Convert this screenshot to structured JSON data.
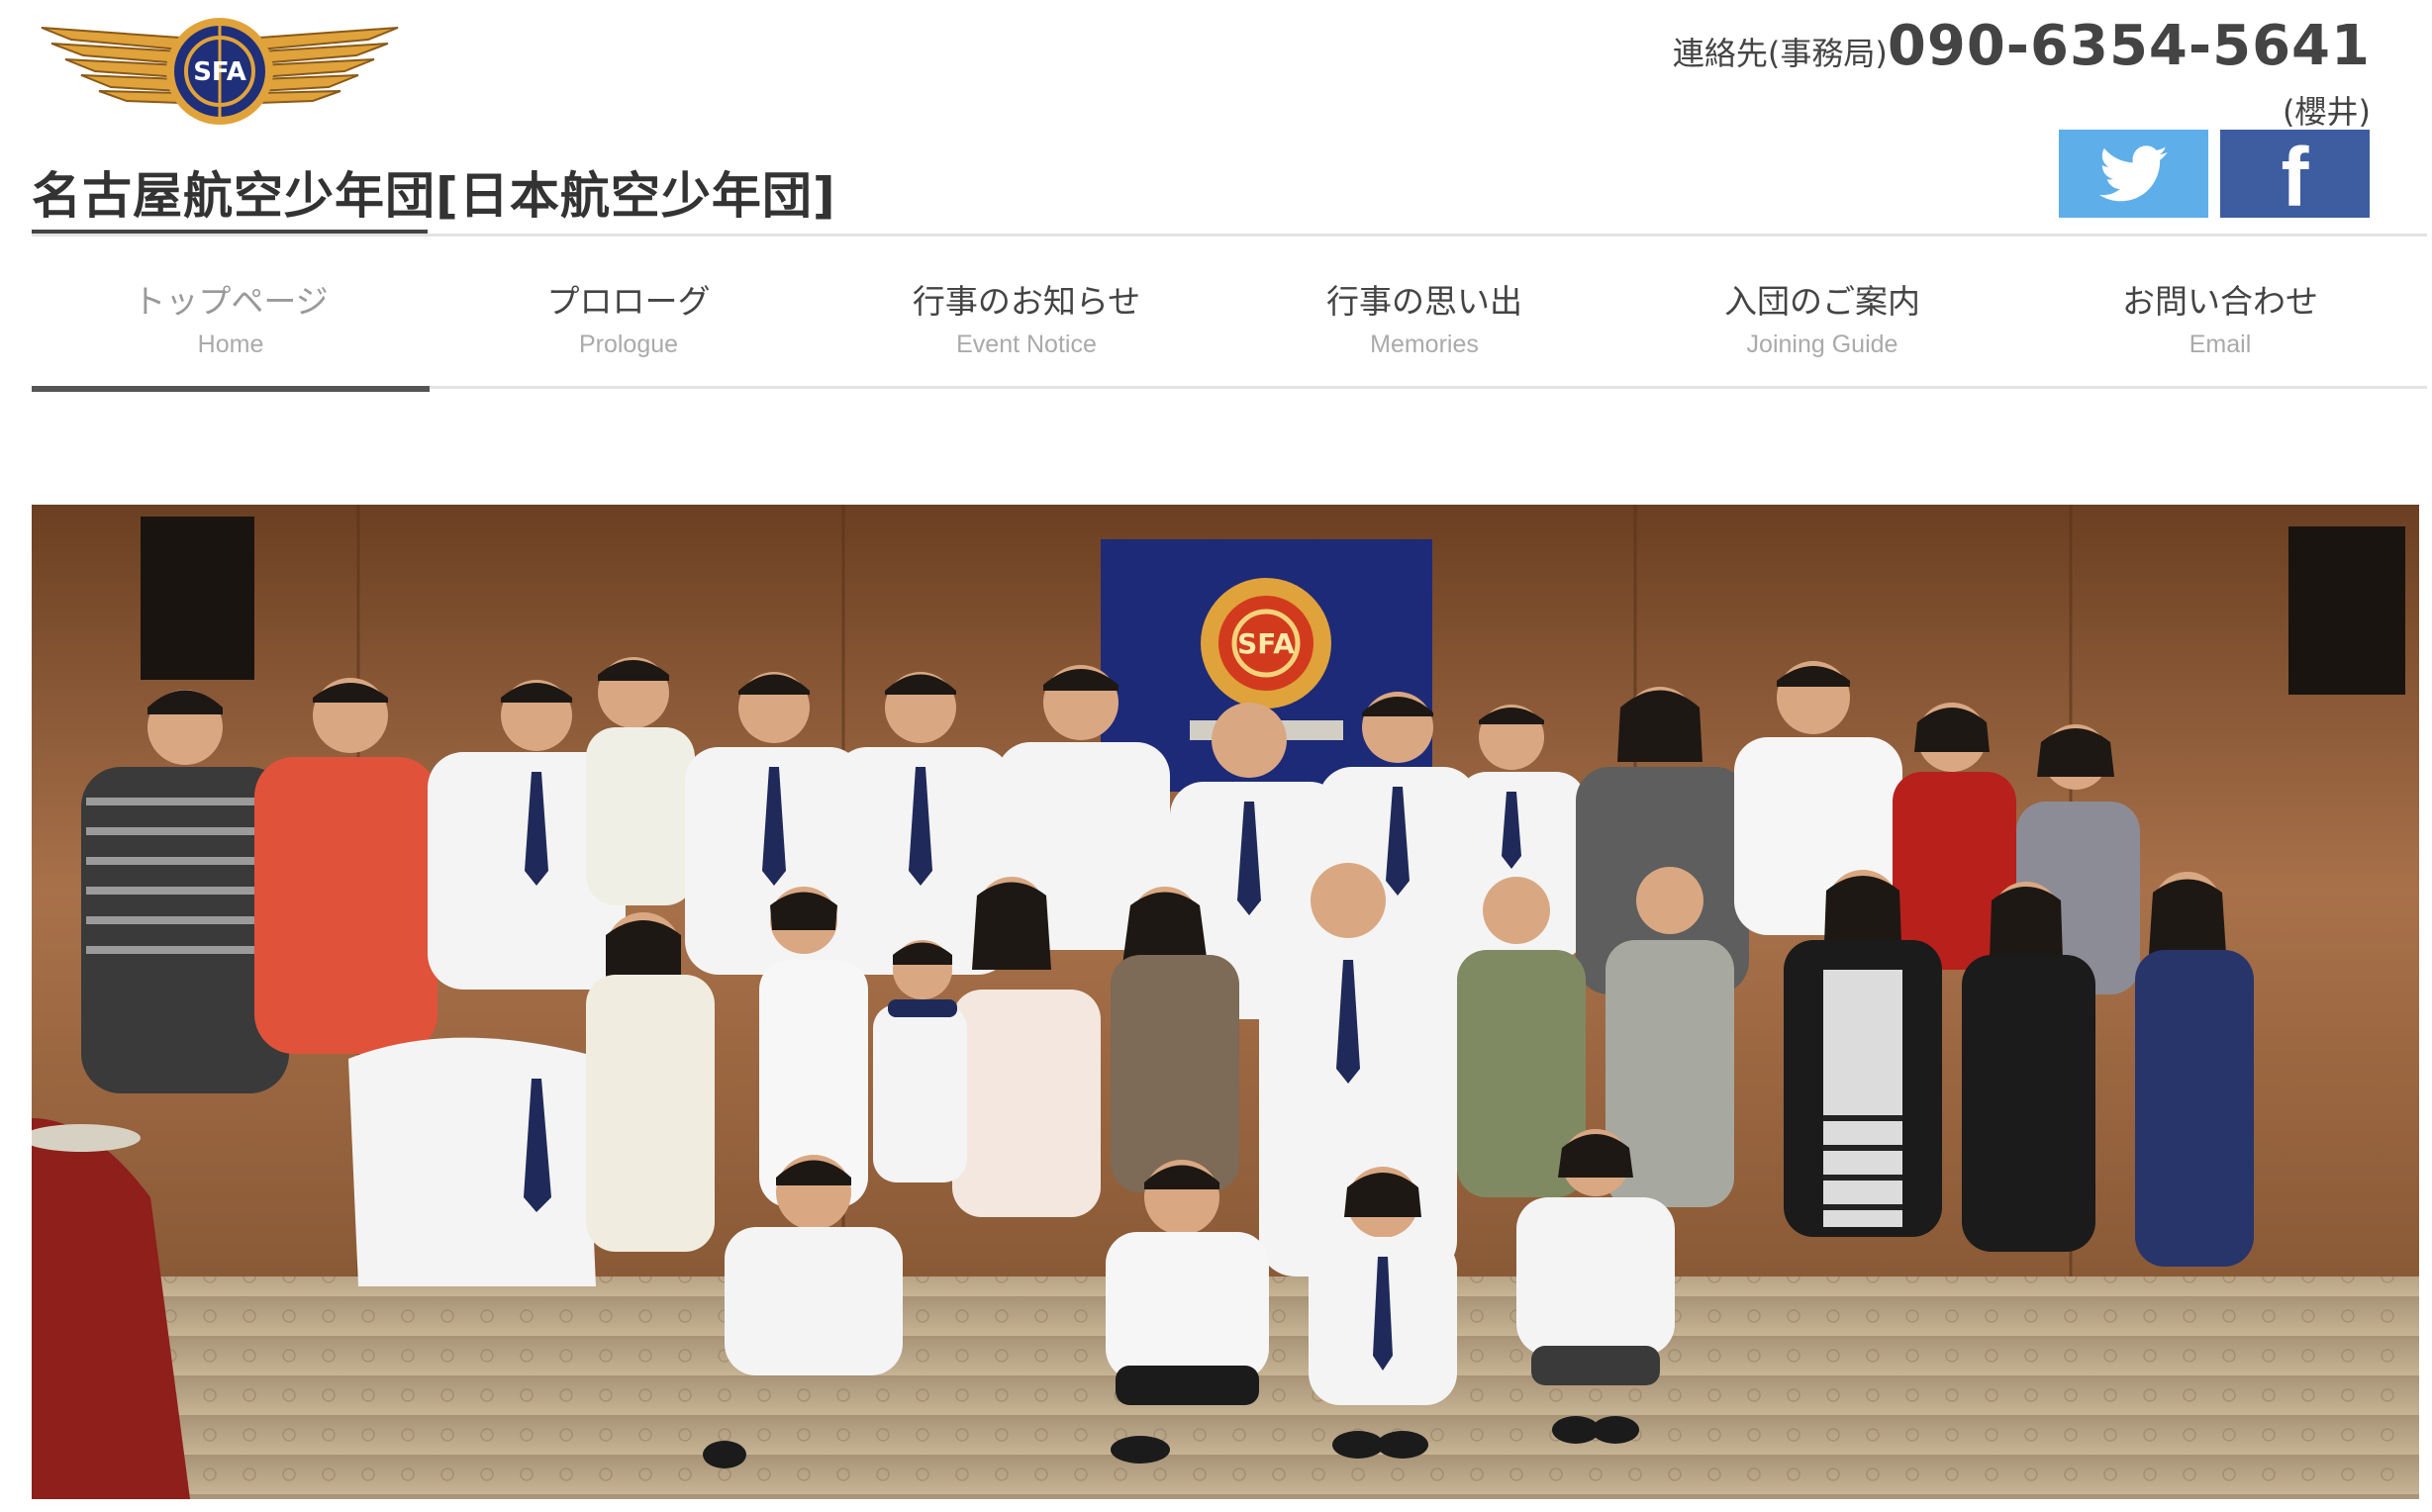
{
  "header": {
    "logo_text": "SFA",
    "site_title": "名古屋航空少年団[日本航空少年団]",
    "contact_label": "連絡先(事務局)",
    "contact_phone": "090-6354-5641",
    "contact_person": "(櫻井)"
  },
  "social": {
    "twitter_icon": "twitter-bird-icon",
    "facebook_icon": "facebook-f-icon",
    "facebook_glyph": "f",
    "twitter_color": "#5eaeea",
    "facebook_color": "#3e5da0"
  },
  "nav": {
    "items": [
      {
        "jp": "トップページ",
        "en": "Home"
      },
      {
        "jp": "プロローグ",
        "en": "Prologue"
      },
      {
        "jp": "行事のお知らせ",
        "en": "Event Notice"
      },
      {
        "jp": "行事の思い出",
        "en": "Memories"
      },
      {
        "jp": "入団のご案内",
        "en": "Joining Guide"
      },
      {
        "jp": "お問い合わせ",
        "en": "Email"
      }
    ],
    "active_index": 0
  },
  "hero": {
    "image": "group-photo",
    "banner_text": "SFA"
  }
}
